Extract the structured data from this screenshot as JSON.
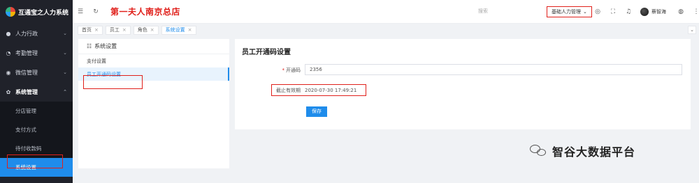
{
  "app": {
    "name": "互通宝之人力系统",
    "store_title": "第一夫人南京总店"
  },
  "sidebar": {
    "items": [
      {
        "label": "人力行政",
        "icon": "team-icon"
      },
      {
        "label": "考勤管理",
        "icon": "clock-icon"
      },
      {
        "label": "微信管理",
        "icon": "wechat-icon"
      },
      {
        "label": "系统管理",
        "icon": "gear-icon"
      }
    ],
    "sub_items": [
      "分店管理",
      "支付方式",
      "待付收款码",
      "系统设置"
    ]
  },
  "topbar": {
    "search_placeholder": "搜索",
    "module_select": "基础人力管理",
    "user_name": "蔡智海"
  },
  "tabs": [
    "首页",
    "员工",
    "角色",
    "系统设置"
  ],
  "left_panel": {
    "title": "系统设置",
    "items": [
      "支付设置",
      "员工开通码设置"
    ]
  },
  "form": {
    "title": "员工开通码设置",
    "code_label": "开通码",
    "code_value": "2356",
    "expiry_label": "截止有效期",
    "expiry_value": "2020-07-30 17:49:21",
    "save_label": "保存"
  },
  "watermark": "智谷大数据平台",
  "colors": {
    "accent": "#1f8ceb",
    "highlight": "#e0201b",
    "sidebar_bg": "#20222a"
  }
}
